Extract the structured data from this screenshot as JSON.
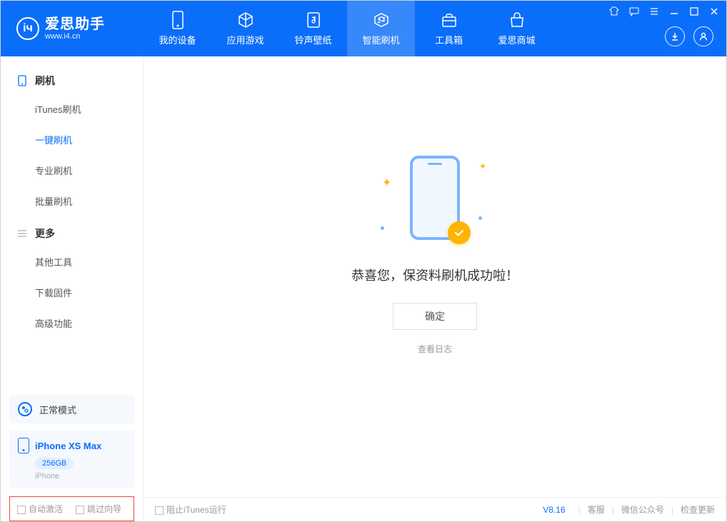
{
  "app": {
    "name_cn": "爱思助手",
    "name_en": "www.i4.cn"
  },
  "nav": {
    "tabs": [
      {
        "label": "我的设备",
        "icon": "device"
      },
      {
        "label": "应用游戏",
        "icon": "cube"
      },
      {
        "label": "铃声壁纸",
        "icon": "music"
      },
      {
        "label": "智能刷机",
        "icon": "refresh",
        "active": true
      },
      {
        "label": "工具箱",
        "icon": "toolbox"
      },
      {
        "label": "爱思商城",
        "icon": "store"
      }
    ]
  },
  "sidebar": {
    "sections": [
      {
        "title": "刷机",
        "icon": "phone",
        "items": [
          {
            "label": "iTunes刷机"
          },
          {
            "label": "一键刷机",
            "active": true
          },
          {
            "label": "专业刷机"
          },
          {
            "label": "批量刷机"
          }
        ]
      },
      {
        "title": "更多",
        "icon": "list",
        "items": [
          {
            "label": "其他工具"
          },
          {
            "label": "下载固件"
          },
          {
            "label": "高级功能"
          }
        ]
      }
    ],
    "mode": "正常模式",
    "device": {
      "name": "iPhone XS Max",
      "capacity": "256GB",
      "type": "iPhone"
    },
    "checkboxes": {
      "auto_activate": "自动激活",
      "skip_guide": "跳过向导"
    }
  },
  "main": {
    "success_msg": "恭喜您，保资料刷机成功啦！",
    "ok_label": "确定",
    "view_log": "查看日志"
  },
  "footer": {
    "block_itunes": "阻止iTunes运行",
    "version": "V8.16",
    "links": [
      "客服",
      "微信公众号",
      "检查更新"
    ]
  }
}
